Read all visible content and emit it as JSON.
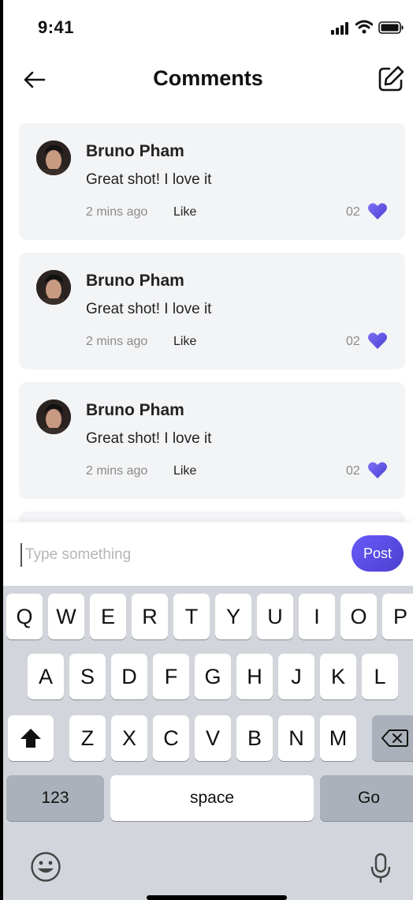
{
  "status_bar": {
    "time": "9:41"
  },
  "header": {
    "title": "Comments"
  },
  "comments": [
    {
      "author": "Bruno Pham",
      "text": "Great shot! I love it",
      "time": "2 mins ago",
      "like_label": "Like",
      "likes": "02"
    },
    {
      "author": "Bruno Pham",
      "text": "Great shot! I love it",
      "time": "2 mins ago",
      "like_label": "Like",
      "likes": "02"
    },
    {
      "author": "Bruno Pham",
      "text": "Great shot! I love it",
      "time": "2 mins ago",
      "like_label": "Like",
      "likes": "02"
    }
  ],
  "composer": {
    "placeholder": "Type something",
    "value": "",
    "post_label": "Post"
  },
  "keyboard": {
    "row1": [
      "Q",
      "W",
      "E",
      "R",
      "T",
      "Y",
      "U",
      "I",
      "O",
      "P"
    ],
    "row2": [
      "A",
      "S",
      "D",
      "F",
      "G",
      "H",
      "J",
      "K",
      "L"
    ],
    "row3": [
      "Z",
      "X",
      "C",
      "V",
      "B",
      "N",
      "M"
    ],
    "numbers_label": "123",
    "space_label": "space",
    "go_label": "Go"
  },
  "colors": {
    "accent": "#5b4ee8",
    "card_bg": "#f3f4f6",
    "keyboard_bg": "#d2d5db"
  },
  "icons": [
    "back-arrow-icon",
    "edit-icon",
    "heart-icon",
    "shift-icon",
    "backspace-icon",
    "emoji-icon",
    "microphone-icon"
  ]
}
